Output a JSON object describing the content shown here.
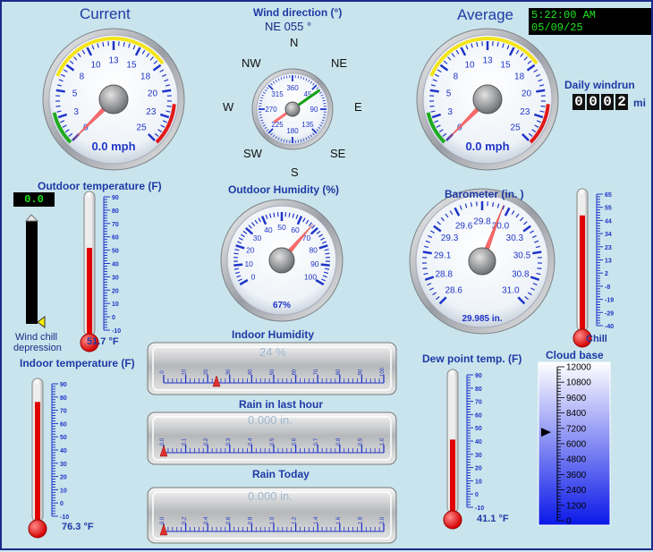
{
  "title": "Current",
  "average": "Average",
  "clock": "5:22:00 AM 05/09/25",
  "wind_current": {
    "ticks": [
      "0",
      "3",
      "5",
      "8",
      "10",
      "13",
      "15",
      "18",
      "20",
      "23",
      "25"
    ],
    "value": 0.0,
    "readout": "0.0 mph"
  },
  "wind_average": {
    "ticks": [
      "0",
      "3",
      "5",
      "8",
      "10",
      "13",
      "15",
      "18",
      "20",
      "23",
      "25"
    ],
    "value": 0.0,
    "readout": "0.0 mph"
  },
  "wind_direction": {
    "title": "Wind direction (°)",
    "readout": "NE 055 °",
    "degrees": 55,
    "points": {
      "n": "N",
      "ne": "NE",
      "e": "E",
      "se": "SE",
      "s": "S",
      "sw": "SW",
      "w": "W",
      "nw": "NW"
    },
    "ticks": [
      "0",
      "45",
      "90",
      "135",
      "180",
      "225",
      "270",
      "315",
      "360"
    ]
  },
  "windrun": {
    "label": "Daily windrun",
    "digits": [
      "0",
      "0",
      "0",
      "2"
    ],
    "unit": "mi"
  },
  "outdoor_temp": {
    "title": "Outdoor temperature (F)",
    "value": 51.7,
    "readout": "51.7 °F",
    "ticks": [
      "90",
      "80",
      "70",
      "60",
      "50",
      "40",
      "30",
      "20",
      "10",
      "0",
      "-10"
    ]
  },
  "wind_chill": {
    "value": "0.0",
    "label_line1": "Wind chill",
    "label_line2": "depression",
    "level": 0.0
  },
  "outdoor_humidity": {
    "title": "Outdoor Humidity (%)",
    "value": 67,
    "readout": "67%",
    "ticks": [
      "0",
      "10",
      "20",
      "30",
      "40",
      "50",
      "60",
      "70",
      "80",
      "90",
      "100"
    ]
  },
  "barometer": {
    "title": "Barometer (in. )",
    "value": 29.985,
    "readout": "29.985 in.",
    "ticks": [
      "28.6",
      "28.8",
      "29.1",
      "29.3",
      "29.6",
      "29.8",
      "30.0",
      "30.3",
      "30.5",
      "30.8",
      "31.0"
    ]
  },
  "chill": {
    "label": "Chill",
    "value": 48,
    "ticks": [
      "65",
      "55",
      "44",
      "34",
      "23",
      "13",
      "2",
      "-8",
      "-19",
      "-29",
      "-40"
    ]
  },
  "indoor_humidity": {
    "title": "Indoor Humidity",
    "readout": "24 %",
    "value": 24,
    "ticks": [
      "0",
      "10",
      "20",
      "30",
      "40",
      "50",
      "60",
      "70",
      "80",
      "90",
      "100"
    ]
  },
  "rain_hour": {
    "title": "Rain in last hour",
    "readout": "0.000 in.",
    "value": 0.0,
    "ticks": [
      "0.0",
      "0.1",
      "0.2",
      "0.3",
      "0.4",
      "0.5",
      "0.6",
      "0.7",
      "0.8",
      "0.9",
      "1.0"
    ]
  },
  "rain_today": {
    "title": "Rain Today",
    "readout": "0.000 in.",
    "value": 0.0,
    "ticks": [
      "0.0",
      "0.2",
      "0.4",
      "0.6",
      "0.8",
      "1.0",
      "1.2",
      "1.4",
      "1.6",
      "1.8",
      "2.0"
    ]
  },
  "indoor_temp": {
    "title": "Indoor temperature (F)",
    "value": 76.3,
    "readout": "76.3 °F",
    "ticks": [
      "90",
      "80",
      "70",
      "60",
      "50",
      "40",
      "30",
      "20",
      "10",
      "0",
      "-10"
    ]
  },
  "dew_point": {
    "title": "Dew point temp. (F)",
    "value": 41.1,
    "readout": "41.1 °F",
    "ticks": [
      "90",
      "80",
      "70",
      "60",
      "50",
      "40",
      "30",
      "20",
      "10",
      "0",
      "-10"
    ]
  },
  "cloud_base": {
    "title": "Cloud base",
    "value": 6900,
    "ticks": [
      "12000",
      "10800",
      "9600",
      "8400",
      "7200",
      "6000",
      "4800",
      "3600",
      "2400",
      "1200",
      "0"
    ]
  }
}
